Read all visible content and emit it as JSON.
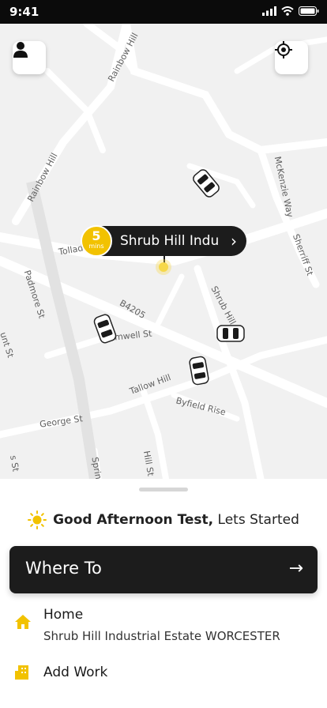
{
  "status_bar": {
    "time": "9:41"
  },
  "map": {
    "labels": {
      "rainbow_hill_1": "Rainbow Hill",
      "rainbow_hill_2": "Rainbow Hill",
      "mckenzie_way": "McKenzie Way",
      "sherriff_st": "Sherriff St",
      "tolladine": "Tollad",
      "padmore_st": "Padmore St",
      "b4205": "B4205",
      "shrub_hill": "Shrub Hill",
      "cromwell_st": "mwell St",
      "mount_st": "unt St",
      "tallow_hill": "Tallow Hill",
      "byfield_rise": "Byfield Rise",
      "george_st": "George St",
      "hill_st": "Hill St",
      "spring": "Sprin",
      "left_st": "s St"
    },
    "pickup": {
      "eta_value": "5",
      "eta_unit": "mins",
      "name": "Shrub Hill Indu"
    }
  },
  "sheet": {
    "greeting_bold": "Good Afternoon Test,",
    "greeting_rest": "Lets Started",
    "where_to": "Where To",
    "home": {
      "title": "Home",
      "address": "Shrub Hill Industrial Estate WORCESTER"
    },
    "work": {
      "title": "Add Work"
    }
  },
  "colors": {
    "accent": "#F2C200",
    "dark": "#1C1C1C",
    "map_bg": "#F1F1F1"
  }
}
